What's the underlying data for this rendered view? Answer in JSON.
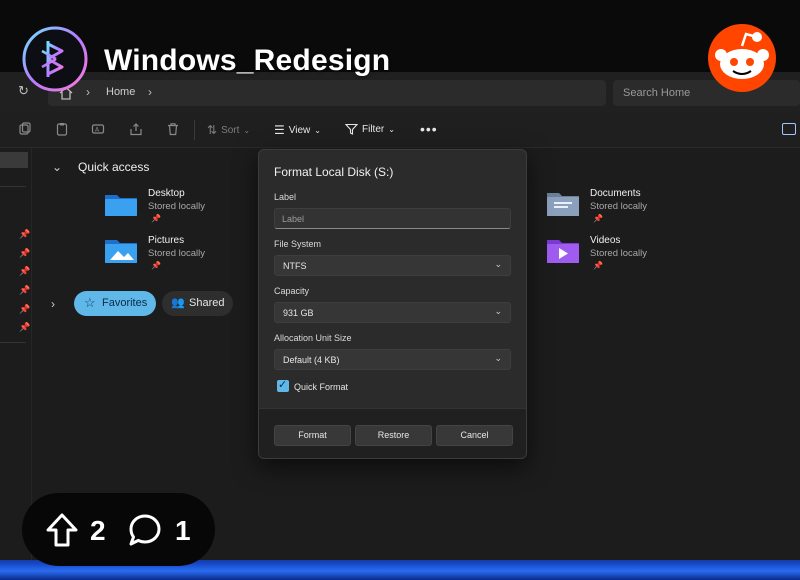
{
  "post": {
    "title": "Windows_Redesign",
    "upvotes": "2",
    "comments": "1"
  },
  "explorer": {
    "breadcrumb": {
      "home": "Home"
    },
    "search": {
      "placeholder": "Search Home"
    },
    "toolbar": {
      "sort_label": "Sort",
      "view_label": "View",
      "filter_label": "Filter",
      "more_label": "•••"
    },
    "quick_access": {
      "title": "Quick access",
      "items": [
        {
          "name": "Desktop",
          "status": "Stored locally",
          "icon": "desktop-folder-icon"
        },
        {
          "name": "Pictures",
          "status": "Stored locally",
          "icon": "pictures-folder-icon"
        },
        {
          "name": "Documents",
          "status": "Stored locally",
          "icon": "documents-folder-icon"
        },
        {
          "name": "Videos",
          "status": "Stored locally",
          "icon": "videos-folder-icon"
        }
      ]
    },
    "filters": {
      "favorites_label": "Favorites",
      "shared_label": "Shared"
    }
  },
  "dialog": {
    "title": "Format Local Disk (S:)",
    "label_field": {
      "label": "Label",
      "placeholder": "Label"
    },
    "file_system": {
      "label": "File System",
      "value": "NTFS"
    },
    "capacity": {
      "label": "Capacity",
      "value": "931 GB"
    },
    "allocation": {
      "label": "Allocation Unit Size",
      "value": "Default (4 KB)"
    },
    "quick_format": {
      "label": "Quick Format",
      "checked": true
    },
    "buttons": {
      "format": "Format",
      "restore": "Restore",
      "cancel": "Cancel"
    }
  },
  "colors": {
    "accent": "#5fb8e8",
    "reddit_orange": "#ff4500",
    "window_bg": "#1c1c1c",
    "dialog_bg": "#2b2b2b"
  }
}
